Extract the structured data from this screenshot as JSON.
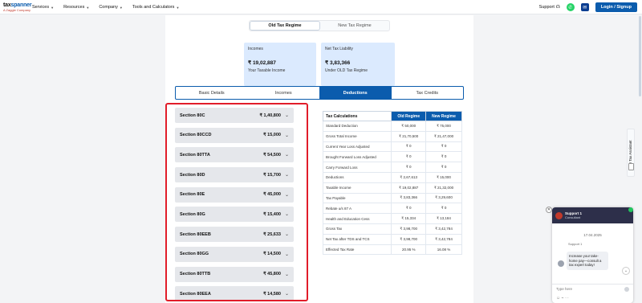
{
  "brand": {
    "name_a": "tax",
    "name_b": "spanner",
    "tagline": "A Zaggle Company",
    "colors": {
      "primary": "#0b5cad",
      "highlight": "#e11d2a",
      "info_bg": "#dbeafe"
    }
  },
  "nav": {
    "links": [
      {
        "label": "Services"
      },
      {
        "label": "Resources"
      },
      {
        "label": "Company"
      },
      {
        "label": "Tools and Calculators"
      }
    ],
    "support_label": "Support",
    "login_label": "Login / Signup"
  },
  "regime_toggle": {
    "options": [
      "Old Tax Regime",
      "New Tax Regime"
    ],
    "selected": "Old Tax Regime"
  },
  "incomes_box": {
    "label": "Incomes",
    "value": "₹ 19,02,887",
    "sub": "Your Taxable Income"
  },
  "liability_box": {
    "label": "Net Tax Liability",
    "value": "₹ 3,83,366",
    "sub": "Under OLD Tax Regime"
  },
  "tabs": [
    {
      "label": "Basic Details"
    },
    {
      "label": "Incomes"
    },
    {
      "label": "Deductions"
    },
    {
      "label": "Tax Credits"
    }
  ],
  "active_tab": "Deductions",
  "sections": [
    {
      "name": "Section 80C",
      "amount": "₹ 1,40,800"
    },
    {
      "name": "Section 80CCD",
      "amount": "₹ 15,000"
    },
    {
      "name": "Section 80TTA",
      "amount": "₹ 54,500"
    },
    {
      "name": "Section 80D",
      "amount": "₹ 15,700"
    },
    {
      "name": "Section 80E",
      "amount": "₹ 45,000"
    },
    {
      "name": "Section 80G",
      "amount": "₹ 15,400"
    },
    {
      "name": "Section 80EEB",
      "amount": "₹ 25,633"
    },
    {
      "name": "Section 80GG",
      "amount": "₹ 14,500"
    },
    {
      "name": "Section 80TTB",
      "amount": "₹ 45,800"
    },
    {
      "name": "Section 80EEA",
      "amount": "₹ 14,580"
    }
  ],
  "calc_table": {
    "headers": [
      "Tax Calculations",
      "Old Regime",
      "New Regime"
    ],
    "rows": [
      [
        "Standard Deduction",
        "₹ 50,000",
        "₹ 75,000"
      ],
      [
        "Gross Total Income",
        "₹ 21,70,500",
        "₹ 21,47,000"
      ],
      [
        "Current Year Loss Adjusted",
        "₹ 0",
        "₹ 0"
      ],
      [
        "Brought Forward Loss Adjusted",
        "₹ 0",
        "₹ 0"
      ],
      [
        "Carry Forward Loss",
        "₹ 0",
        "₹ 0"
      ],
      [
        "Deductions",
        "₹ 2,67,613",
        "₹ 15,000"
      ],
      [
        "Taxable Income",
        "₹ 19,02,887",
        "₹ 21,32,000"
      ],
      [
        "Tax Payable",
        "₹ 3,83,366",
        "₹ 3,29,600"
      ],
      [
        "Rebate u/s 87 A",
        "₹ 0",
        "₹ 0"
      ],
      [
        "Health and Education Cess",
        "₹ 15,334",
        "₹ 13,184"
      ],
      [
        "Gross Tax",
        "₹ 3,98,700",
        "₹ 3,42,784"
      ],
      [
        "Net Tax after TDS and TCS",
        "₹ 3,98,700",
        "₹ 3,42,784"
      ],
      [
        "Effected Tax Rate",
        "20.95 %",
        "16.08 %"
      ]
    ]
  },
  "side_assistant": {
    "label": "Your Tax Assistant"
  },
  "chat": {
    "agent_name": "Support 1",
    "agent_role": "Consultant",
    "date": "17.04.2025",
    "agent_label": "Support 1",
    "message": "Increase your take-home pay—consult a tax expert today!",
    "input_placeholder": "Type here"
  }
}
